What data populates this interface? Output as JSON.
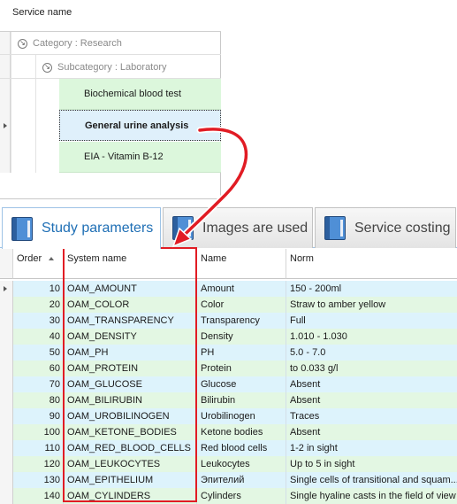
{
  "tree": {
    "header": "Service name",
    "category": "Category : Research",
    "subcategory": "Subcategory : Laboratory",
    "services": [
      "Biochemical blood test",
      "General urine analysis",
      "EIA - Vitamin B-12"
    ]
  },
  "tabs": [
    {
      "label": "Study parameters",
      "icon": "book-icon"
    },
    {
      "label": "Images are used",
      "icon": "book-icon"
    },
    {
      "label": "Service costing",
      "icon": "book-icon"
    }
  ],
  "grid": {
    "columns": [
      "Order",
      "System name",
      "Name",
      "Norm"
    ],
    "rows": [
      {
        "order": "10",
        "system": "OAM_AMOUNT",
        "name": "Amount",
        "norm": "150 - 200ml"
      },
      {
        "order": "20",
        "system": "OAM_COLOR",
        "name": "Color",
        "norm": "Straw to amber yellow"
      },
      {
        "order": "30",
        "system": "OAM_TRANSPARENCY",
        "name": "Transparency",
        "norm": "Full"
      },
      {
        "order": "40",
        "system": "OAM_DENSITY",
        "name": "Density",
        "norm": "1.010 - 1.030"
      },
      {
        "order": "50",
        "system": "OAM_PH",
        "name": "PH",
        "norm": "5.0 - 7.0"
      },
      {
        "order": "60",
        "system": "OAM_PROTEIN",
        "name": "Protein",
        "norm": "to 0.033 g/l"
      },
      {
        "order": "70",
        "system": "OAM_GLUCOSE",
        "name": "Glucose",
        "norm": "Absent"
      },
      {
        "order": "80",
        "system": "OAM_BILIRUBIN",
        "name": "Bilirubin",
        "norm": "Absent"
      },
      {
        "order": "90",
        "system": "OAM_UROBILINOGEN",
        "name": "Urobilinogen",
        "norm": "Traces"
      },
      {
        "order": "100",
        "system": "OAM_KETONE_BODIES",
        "name": "Ketone bodies",
        "norm": "Absent"
      },
      {
        "order": "110",
        "system": "OAM_RED_BLOOD_CELLS",
        "name": "Red blood cells",
        "norm": "1-2 in sight"
      },
      {
        "order": "120",
        "system": "OAM_LEUKOCYTES",
        "name": "Leukocytes",
        "norm": "Up to 5 in sight"
      },
      {
        "order": "130",
        "system": "OAM_EPITHELIUM",
        "name": "Эпителий",
        "norm": "Single cells of transitional and squam..."
      },
      {
        "order": "140",
        "system": "OAM_CYLINDERS",
        "name": "Cylinders",
        "norm": "Single hyaline casts in the field of view"
      }
    ]
  },
  "colors": {
    "highlight": "#e11c24",
    "active_tab": "#1f6fb5",
    "row_blue": "#ddf3fc",
    "row_green": "#e3f7e3"
  }
}
